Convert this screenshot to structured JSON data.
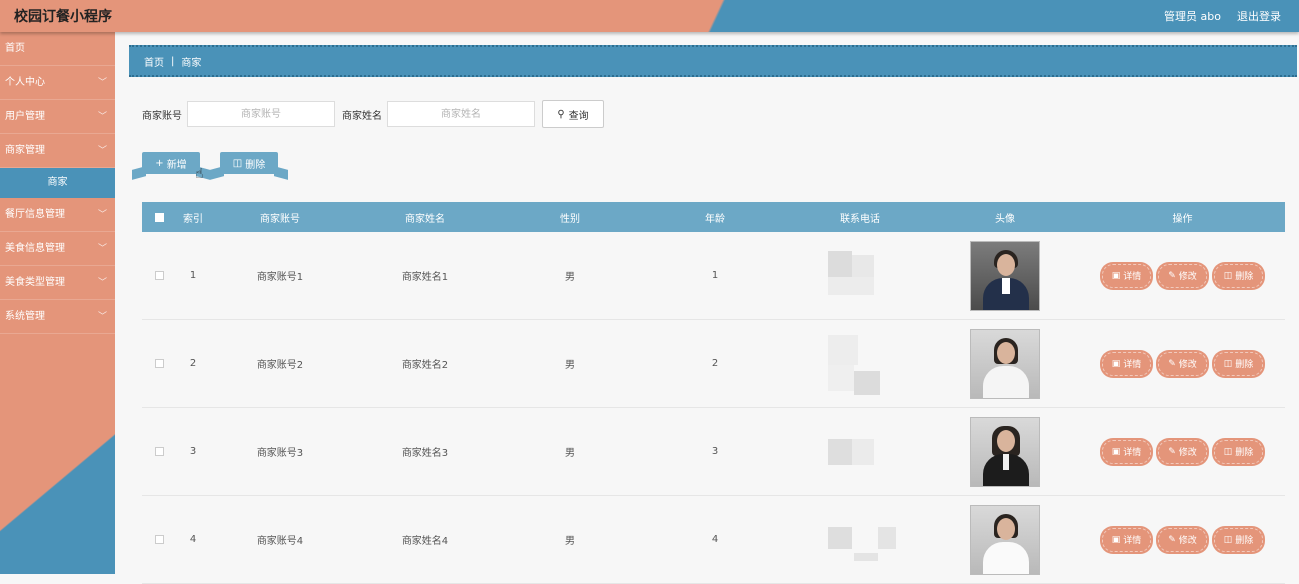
{
  "header": {
    "title": "校园订餐小程序",
    "user_label": "管理员 abo",
    "logout_label": "退出登录"
  },
  "sidebar": {
    "items": [
      {
        "label": "首页",
        "has_children": false
      },
      {
        "label": "个人中心",
        "has_children": true
      },
      {
        "label": "用户管理",
        "has_children": true
      },
      {
        "label": "商家管理",
        "has_children": true
      }
    ],
    "active_sub": "商家",
    "items_after": [
      {
        "label": "餐厅信息管理",
        "has_children": true
      },
      {
        "label": "美食信息管理",
        "has_children": true
      },
      {
        "label": "美食类型管理",
        "has_children": true
      },
      {
        "label": "系统管理",
        "has_children": true
      }
    ]
  },
  "breadcrumb": {
    "home": "首页",
    "separator": "|",
    "current": "商家"
  },
  "search": {
    "account_label": "商家账号",
    "account_placeholder": "商家账号",
    "name_label": "商家姓名",
    "name_placeholder": "商家姓名",
    "query_label": "查询"
  },
  "actions": {
    "add_label": "新增",
    "delete_label": "删除"
  },
  "table": {
    "columns": [
      "索引",
      "商家账号",
      "商家姓名",
      "性别",
      "年龄",
      "联系电话",
      "头像",
      "操作"
    ],
    "rows": [
      {
        "index": "1",
        "account": "商家账号1",
        "name": "商家姓名1",
        "gender": "男",
        "age": "1"
      },
      {
        "index": "2",
        "account": "商家账号2",
        "name": "商家姓名2",
        "gender": "男",
        "age": "2"
      },
      {
        "index": "3",
        "account": "商家账号3",
        "name": "商家姓名3",
        "gender": "男",
        "age": "3"
      },
      {
        "index": "4",
        "account": "商家账号4",
        "name": "商家姓名4",
        "gender": "男",
        "age": "4"
      }
    ],
    "ops": {
      "detail_label": "详情",
      "edit_label": "修改",
      "delete_label": "删除"
    }
  },
  "colors": {
    "accent_salmon": "#e4957a",
    "accent_blue": "#4a92b8",
    "table_header": "#6ca8c6"
  }
}
